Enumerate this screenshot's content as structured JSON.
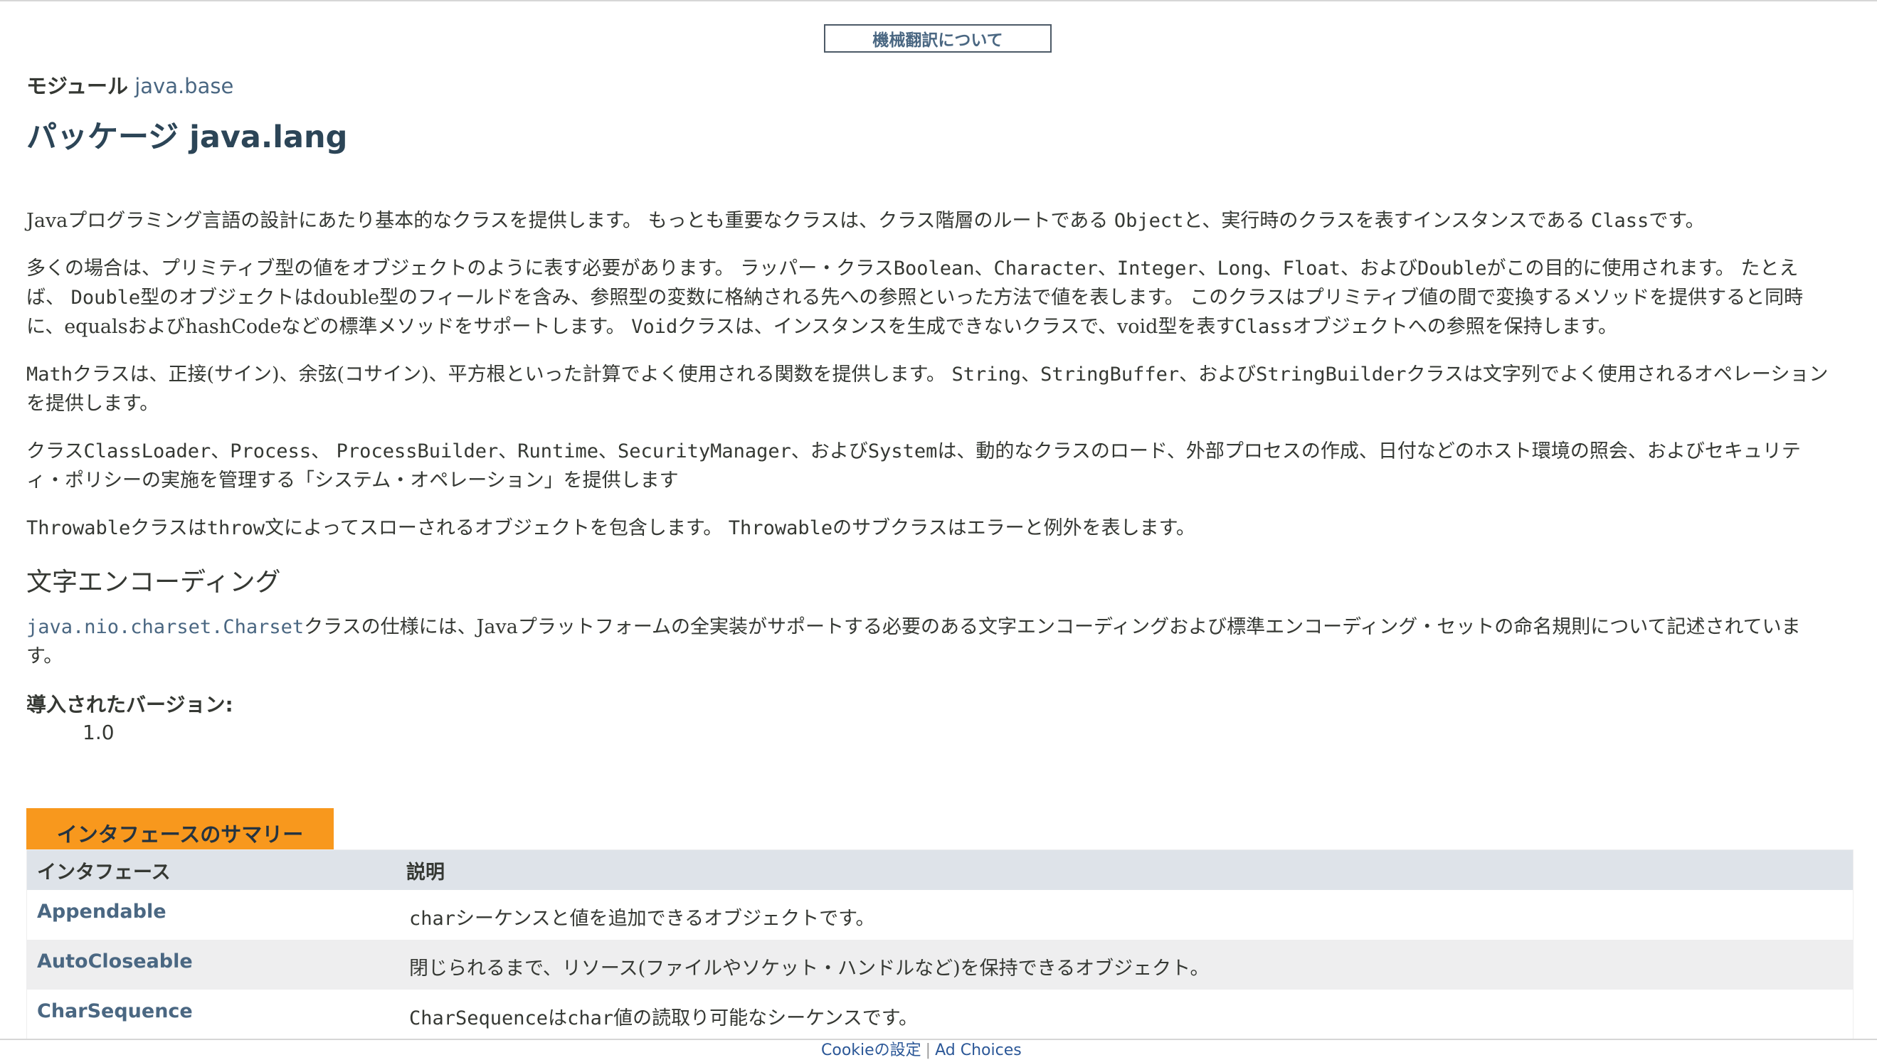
{
  "machine_translation_button": "機械翻訳について",
  "module": {
    "label": "モジュール",
    "name": "java.base"
  },
  "package_title": "パッケージ java.lang",
  "intro": {
    "p1": {
      "a": "Javaプログラミング言語の設計にあたり基本的なクラスを提供します。 もっとも重要なクラスは、クラス階層のルートである ",
      "code1": "Object",
      "b": "と、実行時のクラスを表すインスタンスである ",
      "code2": "Class",
      "c": "です。"
    },
    "p2": {
      "a": "多くの場合は、プリミティブ型の値をオブジェクトのように表す必要があります。 ラッパー・クラス",
      "code1": "Boolean",
      "s1": "、",
      "code2": "Character",
      "s2": "、",
      "code3": "Integer",
      "s3": "、",
      "code4": "Long",
      "s4": "、",
      "code5": "Float",
      "s5": "、および",
      "code6": "Double",
      "b": "がこの目的に使用されます。 たとえば、 ",
      "code7": "Double",
      "c": "型のオブジェクトはdouble型のフィールドを含み、参照型の変数に格納される先への参照といった方法で値を表します。 このクラスはプリミティブ値の間で変換するメソッドを提供すると同時に、equalsおよびhashCodeなどの標準メソッドをサポートします。 ",
      "code8": "Void",
      "d": "クラスは、インスタンスを生成できないクラスで、void型を表す",
      "code9": "Class",
      "e": "オブジェクトへの参照を保持します。"
    },
    "p3": {
      "code1": "Math",
      "a": "クラスは、正接(サイン)、余弦(コサイン)、平方根といった計算でよく使用される関数を提供します。 ",
      "code2": "String",
      "s1": "、",
      "code3": "StringBuffer",
      "s2": "、および",
      "code4": "StringBuilder",
      "b": "クラスは文字列でよく使用されるオペレーションを提供します。"
    },
    "p4": {
      "a": "クラス",
      "code1": "ClassLoader",
      "s1": "、",
      "code2": "Process",
      "s2": "、 ",
      "code3": "ProcessBuilder",
      "s3": "、",
      "code4": "Runtime",
      "s4": "、",
      "code5": "SecurityManager",
      "s5": "、および",
      "code6": "System",
      "b": "は、動的なクラスのロード、外部プロセスの作成、日付などのホスト環境の照会、およびセキュリティ・ポリシーの実施を管理する「システム・オペレーション」を提供します"
    },
    "p5": {
      "code1": "Throwable",
      "a": "クラスは",
      "code2": "throw",
      "b": "文によってスローされるオブジェクトを包含します。 ",
      "code3": "Throwable",
      "c": "のサブクラスはエラーと例外を表します。"
    }
  },
  "encoding": {
    "heading": "文字エンコーディング",
    "link": "java.nio.charset.Charset",
    "text": "クラスの仕様には、Javaプラットフォームの全実装がサポートする必要のある文字エンコーディングおよび標準エンコーディング・セットの命名規則について記述されています。"
  },
  "since": {
    "label": "導入されたバージョン:",
    "value": "1.0"
  },
  "summary": {
    "tab": "インタフェースのサマリー",
    "headers": {
      "col1": "インタフェース",
      "col2": "説明"
    },
    "rows": [
      {
        "name": "Appendable",
        "desc_code": "char",
        "desc": "シーケンスと値を追加できるオブジェクトです。"
      },
      {
        "name": "AutoCloseable",
        "desc_code": "",
        "desc": "閉じられるまで、リソース(ファイルやソケット・ハンドルなど)を保持できるオブジェクト。"
      },
      {
        "name": "CharSequence",
        "desc_code": "CharSequence",
        "desc_mid": "は",
        "desc_code2": "char",
        "desc": "値の読取り可能なシーケンスです。"
      }
    ]
  },
  "footer": {
    "cookie": "Cookieの設定",
    "sep": "|",
    "ad": "Ad Choices"
  }
}
